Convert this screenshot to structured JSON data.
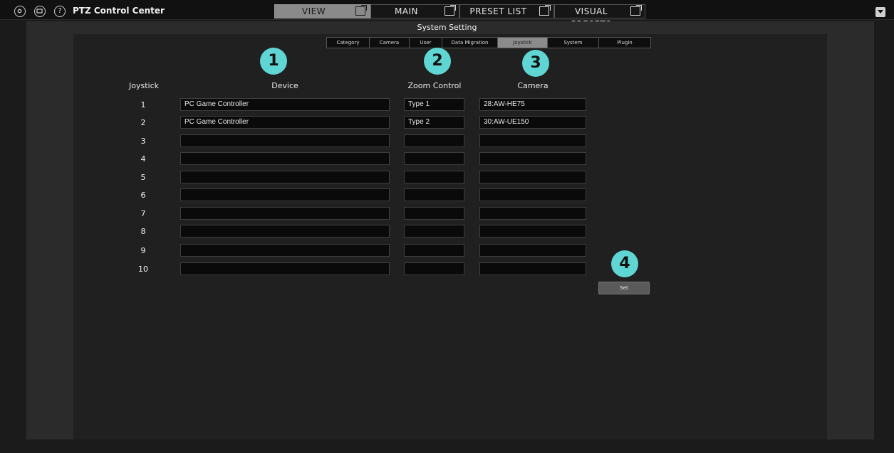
{
  "app_title": "PTZ Control Center",
  "icons": {
    "settings": "gear-icon",
    "camera_list": "camera-list-icon",
    "help": "help-icon",
    "popout": "popout-icon",
    "menu": "dropdown-menu-icon"
  },
  "help_glyph": "?",
  "nav_tabs": [
    {
      "label": "VIEW",
      "active": true
    },
    {
      "label": "MAIN",
      "active": false
    },
    {
      "label": "PRESET LIST",
      "active": false
    },
    {
      "label": "VISUAL PRESETS",
      "active": false
    }
  ],
  "section_title": "System Setting",
  "sub_tabs": [
    {
      "label": "Category",
      "active": false
    },
    {
      "label": "Camera",
      "active": false
    },
    {
      "label": "User",
      "active": false
    },
    {
      "label": "Data Migration",
      "active": false
    },
    {
      "label": "Joystick",
      "active": true
    },
    {
      "label": "System",
      "active": false
    },
    {
      "label": "Plugin",
      "active": false
    }
  ],
  "markers": [
    "1",
    "2",
    "3",
    "4"
  ],
  "columns": {
    "joystick": "Joystick",
    "device": "Device",
    "zoom": "Zoom Control",
    "camera": "Camera"
  },
  "rows": [
    {
      "num": "1",
      "device": "PC Game Controller",
      "zoom": "Type 1",
      "camera": "28:AW-HE75"
    },
    {
      "num": "2",
      "device": "PC Game Controller",
      "zoom": "Type 2",
      "camera": "30:AW-UE150"
    },
    {
      "num": "3",
      "device": "",
      "zoom": "",
      "camera": ""
    },
    {
      "num": "4",
      "device": "",
      "zoom": "",
      "camera": ""
    },
    {
      "num": "5",
      "device": "",
      "zoom": "",
      "camera": ""
    },
    {
      "num": "6",
      "device": "",
      "zoom": "",
      "camera": ""
    },
    {
      "num": "7",
      "device": "",
      "zoom": "",
      "camera": ""
    },
    {
      "num": "8",
      "device": "",
      "zoom": "",
      "camera": ""
    },
    {
      "num": "9",
      "device": "",
      "zoom": "",
      "camera": ""
    },
    {
      "num": "10",
      "device": "",
      "zoom": "",
      "camera": ""
    }
  ],
  "set_label": "Set",
  "colors": {
    "accent_marker": "#5fd6d3",
    "active_tab": "#8a8a8a",
    "background": "#1b1b1b"
  }
}
